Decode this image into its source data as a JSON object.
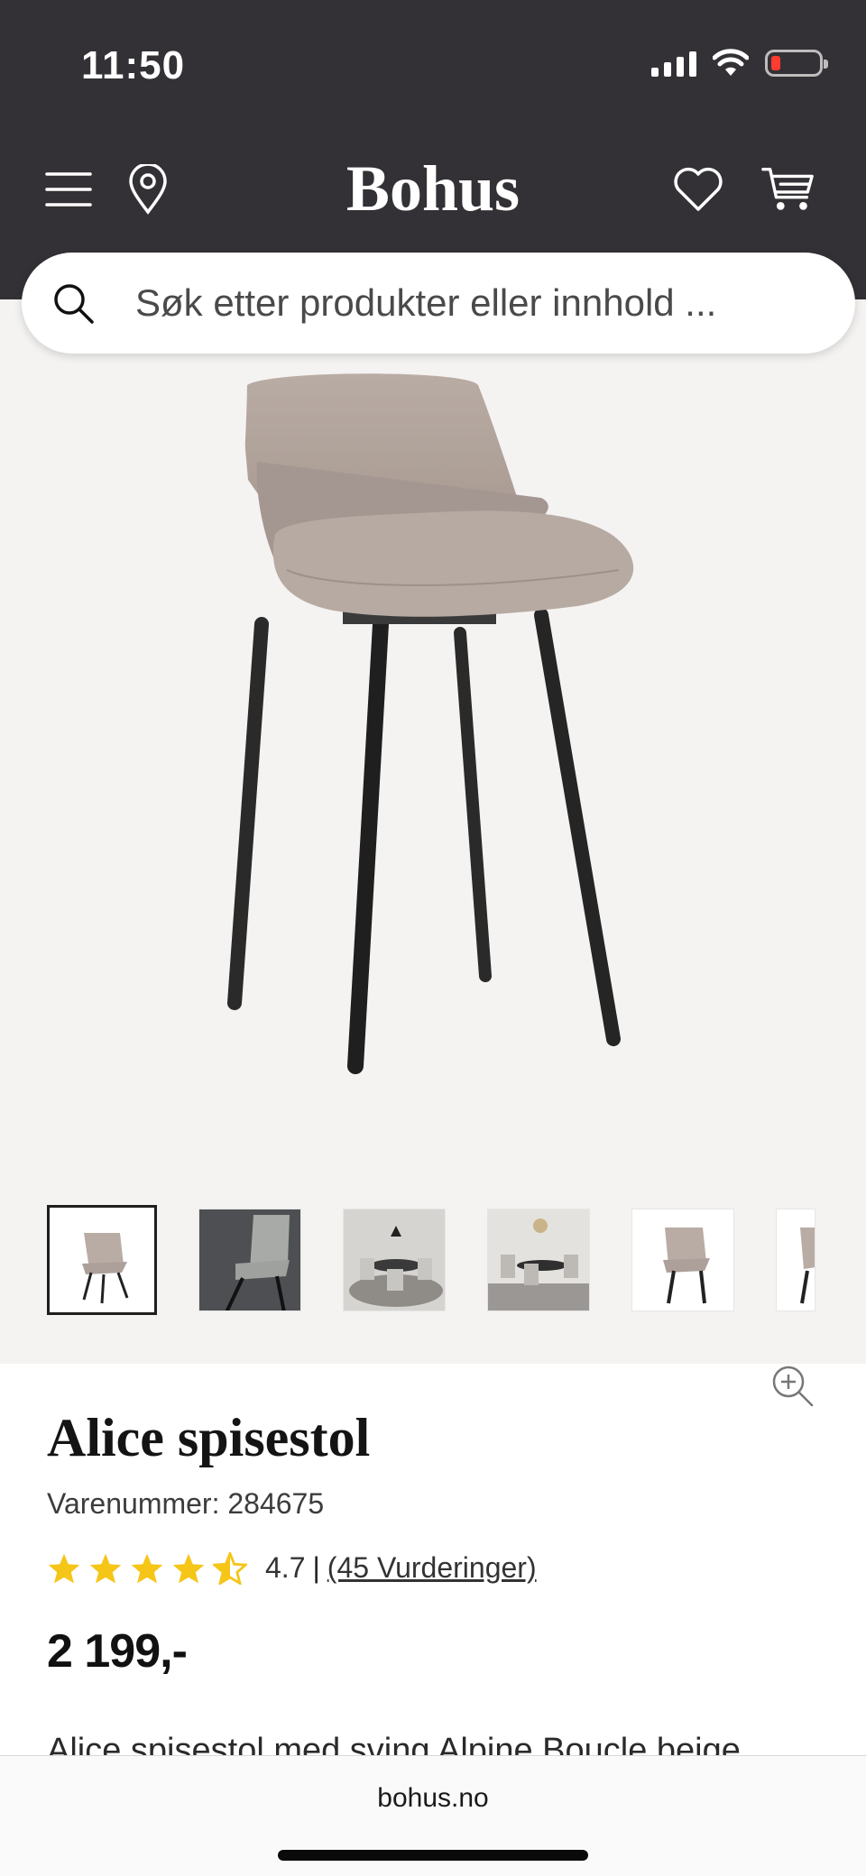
{
  "status_bar": {
    "time": "11:50"
  },
  "header": {
    "logo": "Bohus"
  },
  "search": {
    "placeholder": "Søk etter produkter eller innhold ..."
  },
  "product": {
    "title": "Alice spisestol",
    "sku_label": "Varenummer: 284675",
    "rating_value": "4.7",
    "rating_separator": "|",
    "reviews_label": "(45 Vurderinger)",
    "stars": 4.5,
    "price": "2 199,-",
    "description_preview": "Alice spisestol med sving Alpine Boucle beige"
  },
  "browser": {
    "url": "bohus.no"
  },
  "colors": {
    "header_bg": "#333135",
    "hero_bg": "#f4f3f2",
    "star": "#f5c518",
    "battery_low": "#ff3b30"
  },
  "icons": [
    "menu-icon",
    "location-icon",
    "heart-icon",
    "cart-icon",
    "search-icon",
    "zoom-in-icon"
  ]
}
